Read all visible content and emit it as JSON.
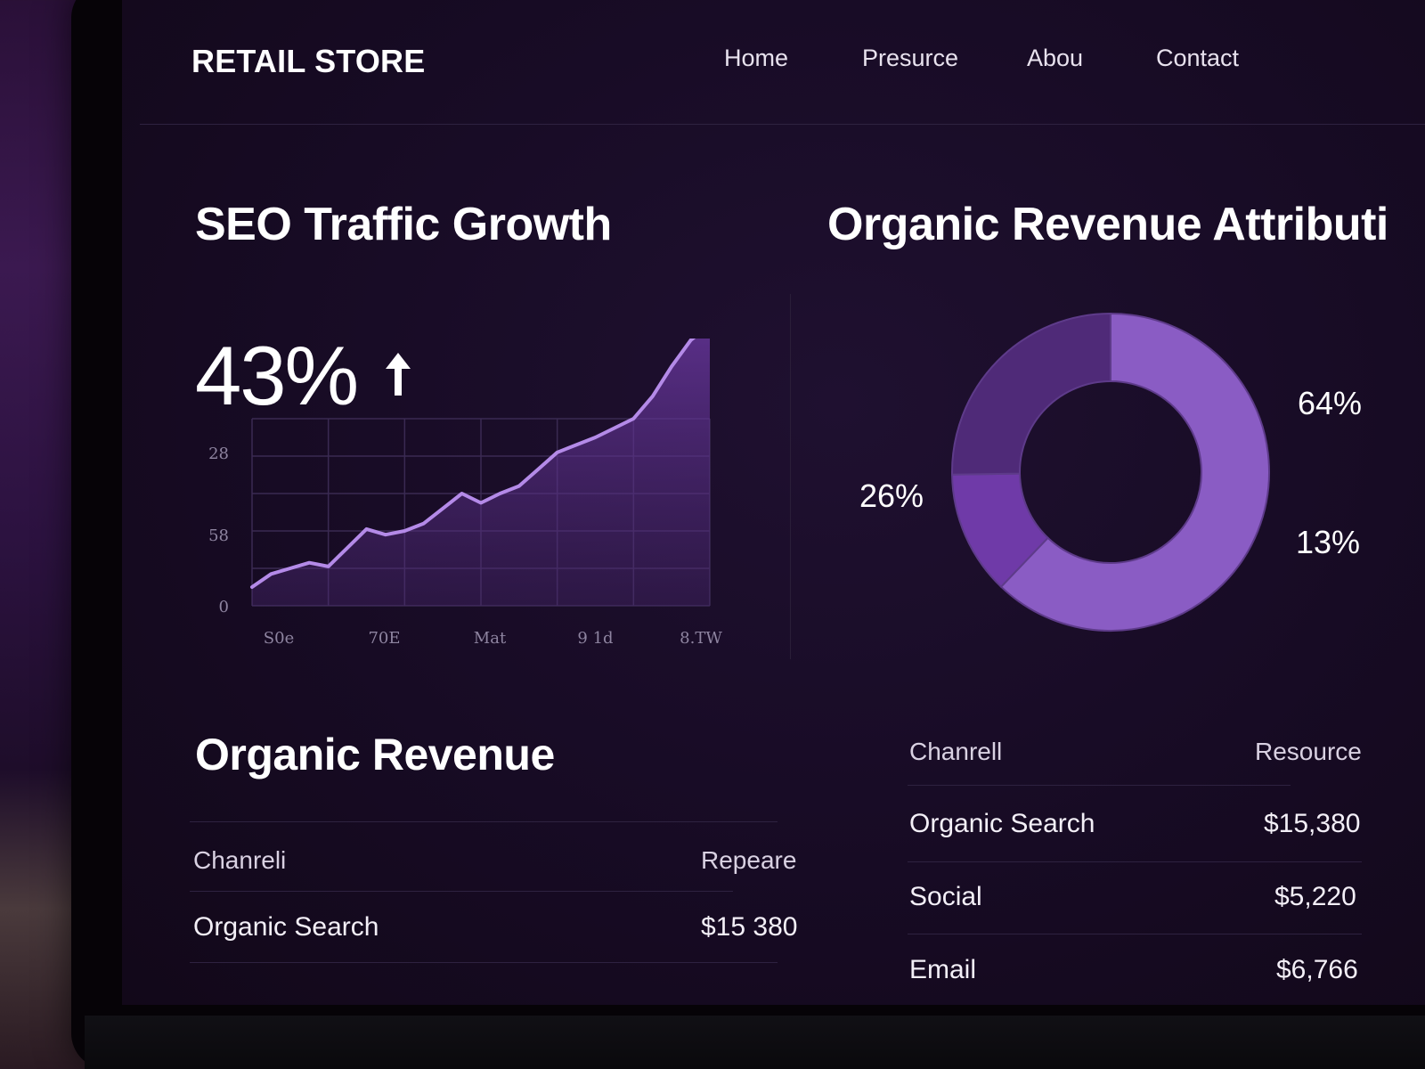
{
  "header": {
    "brand": "RETAIL STORE",
    "nav": [
      {
        "label": "Home"
      },
      {
        "label": "Presurce"
      },
      {
        "label": "Abou"
      },
      {
        "label": "Contact"
      }
    ]
  },
  "traffic": {
    "title": "SEO Traffic Growth",
    "stat": "43%",
    "arrow_icon": "arrow-up-icon"
  },
  "attribution": {
    "title": "Organic Revenue Attributi"
  },
  "revenue": {
    "title": "Organic Revenue",
    "headers": [
      "Chanreli",
      "Repeare"
    ],
    "rows": [
      {
        "channel": "Organic Search",
        "value": "$15 380"
      }
    ]
  },
  "resource_table": {
    "headers": [
      "Chanrell",
      "Resource"
    ],
    "rows": [
      {
        "channel": "Organic Search",
        "value": "$15,380"
      },
      {
        "channel": "Social",
        "value": "$5,220"
      },
      {
        "channel": "Email",
        "value": "$6,766"
      }
    ]
  },
  "colors": {
    "accent": "#9b6bd6",
    "accent_light": "#b48ae8",
    "slice_dark": "#4f2a78",
    "slice_mid": "#6f3aa8",
    "slice_light": "#8a5cc4",
    "background": "#170b24"
  },
  "chart_data": [
    {
      "type": "area",
      "y_tick_labels": [
        "0",
        "58",
        "28"
      ],
      "x_tick_labels": [
        "S0e",
        "70E",
        "Mat",
        "9 1d",
        "8.TW"
      ],
      "ylim": [
        0,
        100
      ],
      "x": [
        0,
        1,
        2,
        3,
        4,
        5,
        6,
        7,
        8,
        9,
        10,
        11,
        12,
        13,
        14,
        15,
        16,
        17,
        18,
        19,
        20,
        21,
        22,
        23,
        24
      ],
      "values": [
        10,
        17,
        20,
        23,
        21,
        31,
        41,
        38,
        40,
        44,
        52,
        60,
        55,
        60,
        64,
        73,
        82,
        86,
        90,
        95,
        100,
        112,
        128,
        142,
        150
      ],
      "grid": true
    },
    {
      "type": "pie",
      "donut": true,
      "slices": [
        {
          "label": "64%",
          "value": 64
        },
        {
          "label": "13%",
          "value": 13
        },
        {
          "label": "26%",
          "value": 26
        }
      ]
    }
  ]
}
